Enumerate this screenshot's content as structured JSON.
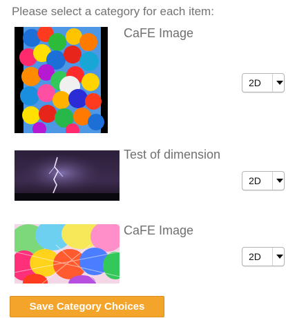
{
  "prompt": "Please select a category for each item:",
  "items": [
    {
      "title": "CaFE Image",
      "selected": "2D",
      "image_icon": "balloons-photo"
    },
    {
      "title": "Test of dimension",
      "selected": "2D",
      "image_icon": "lightning-photo"
    },
    {
      "title": "CaFE Image",
      "selected": "2D",
      "image_icon": "balloons-photo"
    }
  ],
  "save_button": {
    "label": "Save Category Choices",
    "color": "#f2a52a"
  }
}
